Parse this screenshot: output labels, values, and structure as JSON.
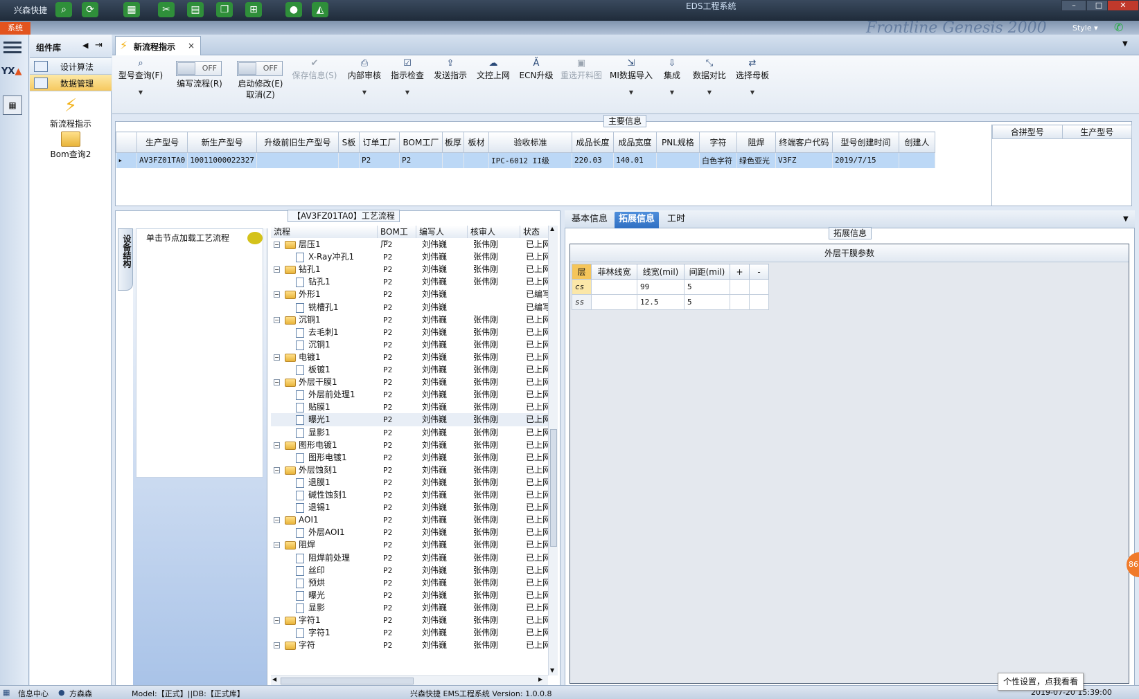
{
  "titlebar": {
    "app_name": "兴森快捷",
    "window_title": "EDS工程系统"
  },
  "ribbon": {
    "system_tab": "系统",
    "style_label": "Style ▾"
  },
  "component_panel": {
    "title": "组件库",
    "nav": [
      {
        "label": "设计算法"
      },
      {
        "label": "数据管理"
      }
    ],
    "items": [
      {
        "label": "新流程指示"
      },
      {
        "label": "Bom查询2"
      }
    ]
  },
  "doc_tab": {
    "label": "新流程指示",
    "close": "×"
  },
  "toolbar": {
    "model_query": "型号查询(F)",
    "toggle_off": "OFF",
    "edit_flow": "编写流程(R)",
    "start_modify": "启动修改(E)",
    "cancel": "取消(Z)",
    "save_info": "保存信息(S)",
    "internal_review": "内部审核",
    "instruct_check": "指示检查",
    "send_instruct": "发送指示",
    "doc_upload": "文控上网",
    "ecn_upgrade": "ECN升级",
    "reselect_chart": "重选开料图",
    "mi_import": "MI数据导入",
    "integrate": "集成",
    "data_compare": "数据对比",
    "select_master": "选择母板"
  },
  "main_info": {
    "title": "主要信息",
    "columns": [
      "生产型号",
      "新生产型号",
      "升级前旧生产型号",
      "S板",
      "订单工厂",
      "BOM工厂",
      "板厚",
      "板材",
      "验收标准",
      "成品长度",
      "成品宽度",
      "PNL规格",
      "字符",
      "阻焊",
      "终端客户代码",
      "型号创建时间",
      "创建人"
    ],
    "row": [
      "AV3FZ01TA0",
      "10011000022327",
      "",
      "",
      "P2",
      "P2",
      "",
      "",
      "IPC-6012 II级",
      "220.03",
      "140.01",
      "",
      "白色字符",
      "绿色亚光",
      "V3FZ",
      "2019/7/15",
      ""
    ],
    "side_columns": [
      "合拼型号",
      "生产型号"
    ]
  },
  "process": {
    "title": "【AV3FZ01TA0】工艺流程",
    "side_tab": "设备结构",
    "hint": "单击节点加载工艺流程",
    "columns": [
      "流程",
      "BOM工厂",
      "编写人",
      "核审人",
      "状态"
    ],
    "rows": [
      {
        "name": "层压1",
        "lvl": 0,
        "bom": "P2",
        "auth": "刘伟巍",
        "rev": "张伟刚",
        "stat": "已上网"
      },
      {
        "name": "X-Ray冲孔1",
        "lvl": 1,
        "bom": "P2",
        "auth": "刘伟巍",
        "rev": "张伟刚",
        "stat": "已上网"
      },
      {
        "name": "钻孔1",
        "lvl": 0,
        "bom": "P2",
        "auth": "刘伟巍",
        "rev": "张伟刚",
        "stat": "已上网"
      },
      {
        "name": "钻孔1",
        "lvl": 1,
        "bom": "P2",
        "auth": "刘伟巍",
        "rev": "张伟刚",
        "stat": "已上网"
      },
      {
        "name": "外形1",
        "lvl": 0,
        "bom": "P2",
        "auth": "刘伟巍",
        "rev": "",
        "stat": "已编写"
      },
      {
        "name": "铣槽孔1",
        "lvl": 1,
        "bom": "P2",
        "auth": "刘伟巍",
        "rev": "",
        "stat": "已编写"
      },
      {
        "name": "沉铜1",
        "lvl": 0,
        "bom": "P2",
        "auth": "刘伟巍",
        "rev": "张伟刚",
        "stat": "已上网"
      },
      {
        "name": "去毛刺1",
        "lvl": 1,
        "bom": "P2",
        "auth": "刘伟巍",
        "rev": "张伟刚",
        "stat": "已上网"
      },
      {
        "name": "沉铜1",
        "lvl": 1,
        "bom": "P2",
        "auth": "刘伟巍",
        "rev": "张伟刚",
        "stat": "已上网"
      },
      {
        "name": "电镀1",
        "lvl": 0,
        "bom": "P2",
        "auth": "刘伟巍",
        "rev": "张伟刚",
        "stat": "已上网"
      },
      {
        "name": "板镀1",
        "lvl": 1,
        "bom": "P2",
        "auth": "刘伟巍",
        "rev": "张伟刚",
        "stat": "已上网"
      },
      {
        "name": "外层干膜1",
        "lvl": 0,
        "bom": "P2",
        "auth": "刘伟巍",
        "rev": "张伟刚",
        "stat": "已上网"
      },
      {
        "name": "外层前处理1",
        "lvl": 1,
        "bom": "P2",
        "auth": "刘伟巍",
        "rev": "张伟刚",
        "stat": "已上网"
      },
      {
        "name": "贴膜1",
        "lvl": 1,
        "bom": "P2",
        "auth": "刘伟巍",
        "rev": "张伟刚",
        "stat": "已上网"
      },
      {
        "name": "曝光1",
        "lvl": 1,
        "bom": "P2",
        "auth": "刘伟巍",
        "rev": "张伟刚",
        "stat": "已上网",
        "hl": true
      },
      {
        "name": "显影1",
        "lvl": 1,
        "bom": "P2",
        "auth": "刘伟巍",
        "rev": "张伟刚",
        "stat": "已上网"
      },
      {
        "name": "图形电镀1",
        "lvl": 0,
        "bom": "P2",
        "auth": "刘伟巍",
        "rev": "张伟刚",
        "stat": "已上网"
      },
      {
        "name": "图形电镀1",
        "lvl": 1,
        "bom": "P2",
        "auth": "刘伟巍",
        "rev": "张伟刚",
        "stat": "已上网"
      },
      {
        "name": "外层蚀刻1",
        "lvl": 0,
        "bom": "P2",
        "auth": "刘伟巍",
        "rev": "张伟刚",
        "stat": "已上网"
      },
      {
        "name": "退膜1",
        "lvl": 1,
        "bom": "P2",
        "auth": "刘伟巍",
        "rev": "张伟刚",
        "stat": "已上网"
      },
      {
        "name": "碱性蚀刻1",
        "lvl": 1,
        "bom": "P2",
        "auth": "刘伟巍",
        "rev": "张伟刚",
        "stat": "已上网"
      },
      {
        "name": "退锡1",
        "lvl": 1,
        "bom": "P2",
        "auth": "刘伟巍",
        "rev": "张伟刚",
        "stat": "已上网"
      },
      {
        "name": "AOI1",
        "lvl": 0,
        "bom": "P2",
        "auth": "刘伟巍",
        "rev": "张伟刚",
        "stat": "已上网"
      },
      {
        "name": "外层AOI1",
        "lvl": 1,
        "bom": "P2",
        "auth": "刘伟巍",
        "rev": "张伟刚",
        "stat": "已上网"
      },
      {
        "name": "阻焊",
        "lvl": 0,
        "bom": "P2",
        "auth": "刘伟巍",
        "rev": "张伟刚",
        "stat": "已上网"
      },
      {
        "name": "阻焊前处理",
        "lvl": 1,
        "bom": "P2",
        "auth": "刘伟巍",
        "rev": "张伟刚",
        "stat": "已上网"
      },
      {
        "name": "丝印",
        "lvl": 1,
        "bom": "P2",
        "auth": "刘伟巍",
        "rev": "张伟刚",
        "stat": "已上网"
      },
      {
        "name": "预烘",
        "lvl": 1,
        "bom": "P2",
        "auth": "刘伟巍",
        "rev": "张伟刚",
        "stat": "已上网"
      },
      {
        "name": "曝光",
        "lvl": 1,
        "bom": "P2",
        "auth": "刘伟巍",
        "rev": "张伟刚",
        "stat": "已上网"
      },
      {
        "name": "显影",
        "lvl": 1,
        "bom": "P2",
        "auth": "刘伟巍",
        "rev": "张伟刚",
        "stat": "已上网"
      },
      {
        "name": "字符1",
        "lvl": 0,
        "bom": "P2",
        "auth": "刘伟巍",
        "rev": "张伟刚",
        "stat": "已上网"
      },
      {
        "name": "字符1",
        "lvl": 1,
        "bom": "P2",
        "auth": "刘伟巍",
        "rev": "张伟刚",
        "stat": "已上网"
      },
      {
        "name": "字符",
        "lvl": 0,
        "bom": "P2",
        "auth": "刘伟巍",
        "rev": "张伟刚",
        "stat": "已上网"
      }
    ]
  },
  "right_tabs": [
    "基本信息",
    "拓展信息",
    "工时"
  ],
  "ext_info": {
    "title": "拓展信息",
    "caption": "外层干膜参数",
    "columns": [
      "层",
      "菲林线宽",
      "线宽(mil)",
      "间距(mil)",
      "+",
      "-"
    ],
    "rows": [
      [
        "cs",
        "",
        "99",
        "5",
        "",
        ""
      ],
      [
        "ss",
        "",
        "12.5",
        "5",
        "",
        ""
      ]
    ]
  },
  "statusbar": {
    "info_center": "信息中心",
    "user": "方森森",
    "model": "Model:【正式】||DB:【正式库】",
    "version": "兴森快捷 EMS工程系统 Version: 1.0.0.8",
    "datetime": "2019-07-20 15:39:00"
  },
  "tooltip": "个性设置，点我看看",
  "badge": "86"
}
